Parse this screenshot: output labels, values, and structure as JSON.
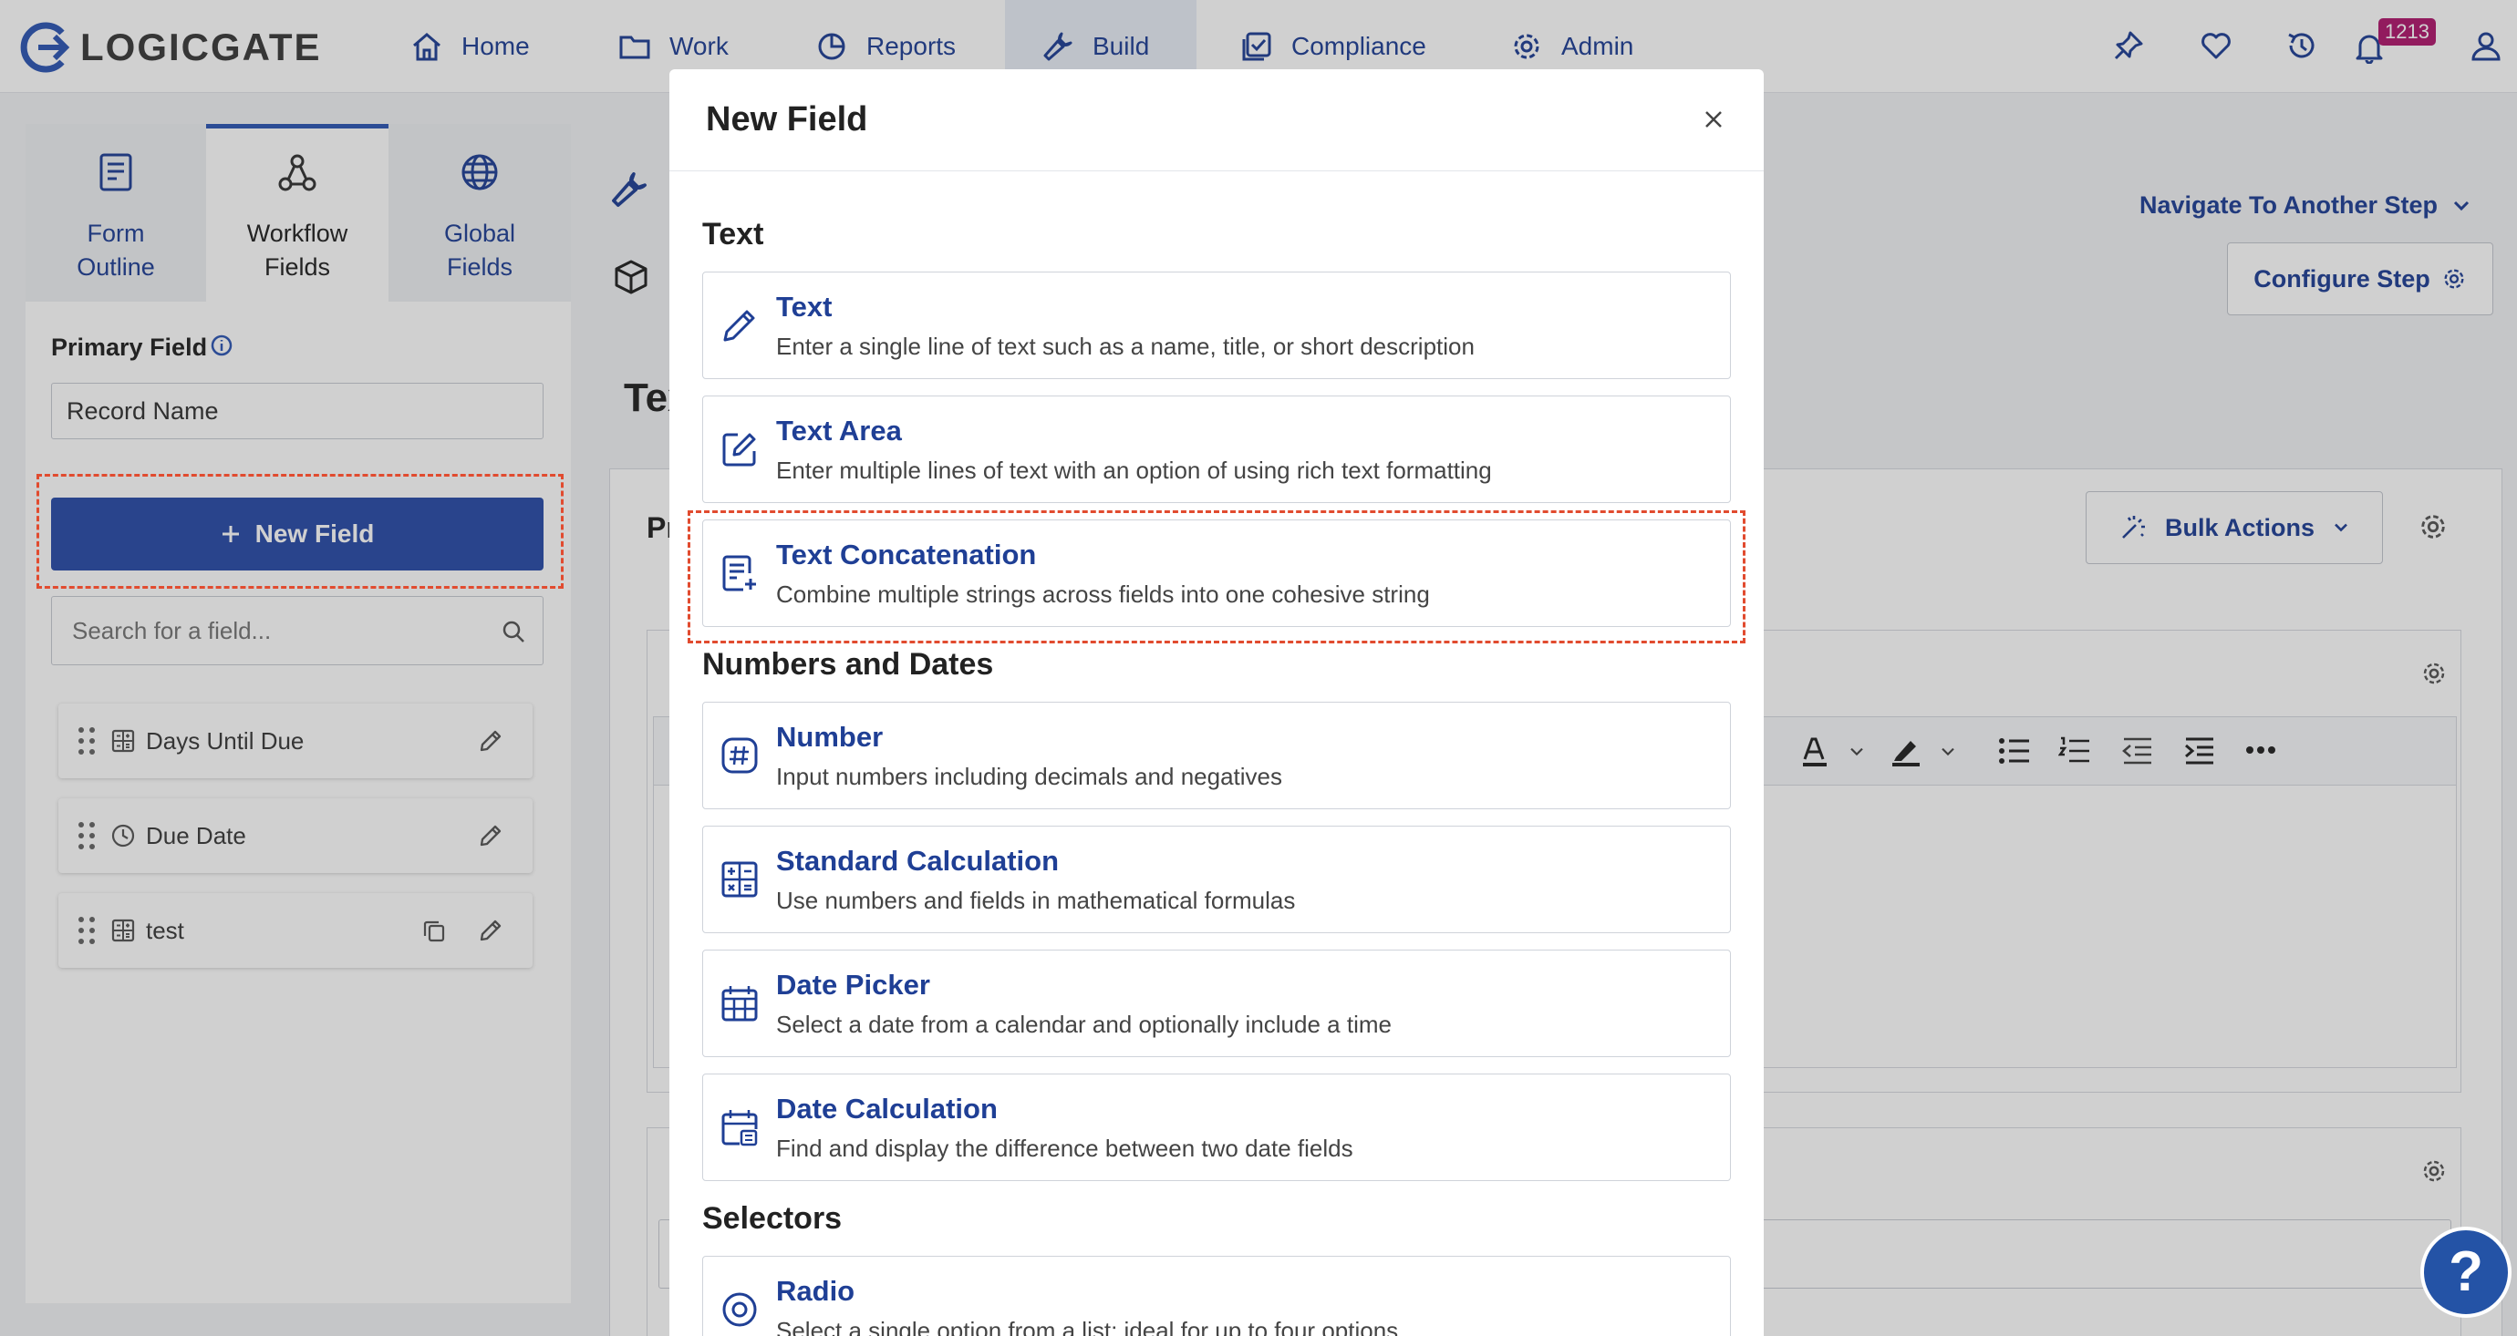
{
  "app": {
    "logo_text": "LOGICGATE"
  },
  "nav": {
    "items": [
      {
        "label": "Home",
        "icon": "home-icon"
      },
      {
        "label": "Work",
        "icon": "folder-icon"
      },
      {
        "label": "Reports",
        "icon": "chart-icon"
      },
      {
        "label": "Build",
        "icon": "wrench-icon",
        "active": true
      },
      {
        "label": "Compliance",
        "icon": "checklist-icon"
      },
      {
        "label": "Admin",
        "icon": "gear-icon"
      }
    ],
    "notification_count": "1213"
  },
  "sidebar": {
    "tabs": [
      {
        "label": "Form\nOutline",
        "icon": "form-icon"
      },
      {
        "label": "Workflow\nFields",
        "icon": "workflow-icon",
        "active": true
      },
      {
        "label": "Global\nFields",
        "icon": "globe-icon"
      }
    ],
    "primary_field_label": "Primary Field",
    "primary_field_value": "Record Name",
    "new_field_label": "New Field",
    "search_placeholder": "Search for a field...",
    "fields": [
      {
        "label": "Days Until Due",
        "icon": "calculator-icon"
      },
      {
        "label": "Due Date",
        "icon": "clock-icon"
      },
      {
        "label": "test",
        "icon": "calculator-icon"
      }
    ]
  },
  "main": {
    "navigate_label": "Navigate To Another Step",
    "configure_label": "Configure Step",
    "bulk_actions_label": "Bulk Actions",
    "title_partial": "Tex",
    "subtitle_partial": "Pr"
  },
  "modal": {
    "title": "New Field",
    "sections": [
      {
        "title": "Text",
        "options": [
          {
            "title": "Text",
            "desc": "Enter a single line of text such as a name, title, or short description",
            "icon": "pencil-icon"
          },
          {
            "title": "Text Area",
            "desc": "Enter multiple lines of text with an option of using rich text formatting",
            "icon": "edit-box-icon"
          },
          {
            "title": "Text Concatenation",
            "desc": "Combine multiple strings across fields into one cohesive string",
            "icon": "concat-icon"
          }
        ]
      },
      {
        "title": "Numbers and Dates",
        "options": [
          {
            "title": "Number",
            "desc": "Input numbers including decimals and negatives",
            "icon": "hash-icon"
          },
          {
            "title": "Standard Calculation",
            "desc": "Use numbers and fields in mathematical formulas",
            "icon": "calculator-icon"
          },
          {
            "title": "Date Picker",
            "desc": "Select a date from a calendar and optionally include a time",
            "icon": "calendar-icon"
          },
          {
            "title": "Date Calculation",
            "desc": "Find and display the difference between two date fields",
            "icon": "calendar-calc-icon"
          }
        ]
      },
      {
        "title": "Selectors",
        "options": [
          {
            "title": "Radio",
            "desc": "Select a single option from a list; ideal for up to four options",
            "icon": "radio-icon"
          }
        ]
      }
    ]
  },
  "help": {
    "label": "?"
  },
  "colors": {
    "brand": "#1f3f95",
    "primary_button": "#2a4ca8",
    "highlight": "#e14b2f",
    "badge": "#b0186e"
  }
}
